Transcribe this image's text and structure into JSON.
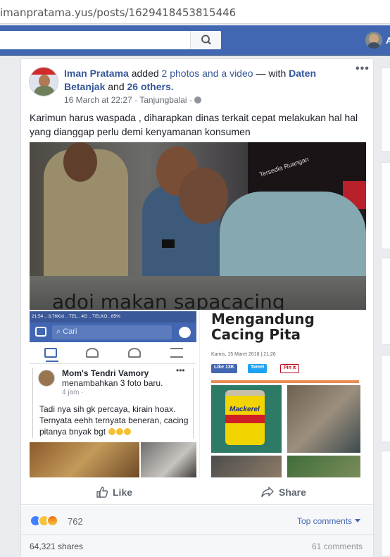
{
  "browser": {
    "url": "imanpratama.yus/posts/1629418453815446"
  },
  "topbar": {
    "search_placeholder": "",
    "profile_name_partial": "A"
  },
  "post": {
    "author": "Iman Pratama",
    "action_text": "added",
    "photos_link": "2 photos and a video",
    "with_text": "— with",
    "tagged_name": "Daten Betanjak",
    "and_text": "and",
    "others_link": "26 others.",
    "date": "16 March at 22:27",
    "separator": "·",
    "location": "Tanjungbalai",
    "more": "•••",
    "text": "Karimun harus waspada , diharapkan dinas terkait cepat melakukan hal hal yang dianggap perlu demi kenyamanan konsumen",
    "media": {
      "main_caption": "adoi makan sapacacing",
      "main_sign_text": "Tersedia Ruangan",
      "left_screenshot": {
        "status_bar": "21:54  ..  3,76K/d  ..  TEL..  4G  ..  TELKO..  85%",
        "search_placeholder": "Cari",
        "card": {
          "name": "Mom's Tendri Vamory",
          "dots": "•••",
          "added": "menambahkan 3 foto baru.",
          "time": "4 jam ·",
          "text": "Tadi nya sih gk percaya, kirain hoax. Ternyata eehh ternyata beneran, cacing pitanya bnyak bgt"
        }
      },
      "right_screenshot": {
        "title": "Mengandung Cacing Pita",
        "date": "Kamis, 15 Maret 2018 | 21:26",
        "like_button": "Like 13K",
        "tweet_button": "Tweet",
        "pin_button": "Pin it",
        "can_label": "Mackerel"
      }
    },
    "actions": {
      "like": "Like",
      "share": "Share"
    },
    "reactions": {
      "count": "762",
      "top_comments": "Top comments"
    },
    "shares": "64,321 shares",
    "comments": "61 comments"
  },
  "colors": {
    "facebook_blue": "#4267b2",
    "link_blue": "#365899",
    "page_bg": "#e9ebee"
  }
}
